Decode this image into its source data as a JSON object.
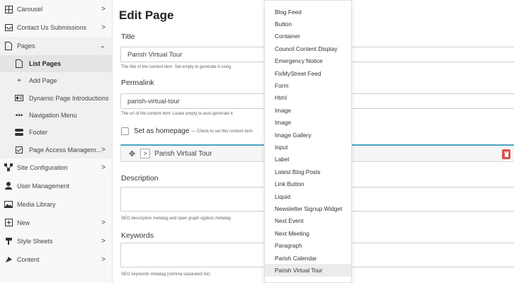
{
  "sidebar": {
    "items": [
      {
        "label": "Carousel",
        "icon": "carousel-icon",
        "chevron": ">"
      },
      {
        "label": "Contact Us Submissions",
        "icon": "inbox-icon",
        "chevron": ">"
      },
      {
        "label": "Pages",
        "icon": "page-icon",
        "chevron": "⌄"
      },
      {
        "label": "List Pages",
        "icon": "page-icon"
      },
      {
        "label": "Add Page",
        "icon": "plus-icon"
      },
      {
        "label": "Dynamic Page Introductions",
        "icon": "id-card-icon"
      },
      {
        "label": "Navigation Menu",
        "icon": "ellipsis-icon"
      },
      {
        "label": "Footer",
        "icon": "footer-icon"
      },
      {
        "label": "Page Access Managem...",
        "icon": "checkbox-icon",
        "chevron": ">"
      },
      {
        "label": "Site Configuration",
        "icon": "sitemap-icon",
        "chevron": ">"
      },
      {
        "label": "User Management",
        "icon": "user-icon"
      },
      {
        "label": "Media Library",
        "icon": "image-icon"
      },
      {
        "label": "New",
        "icon": "plus-square-icon",
        "chevron": ">"
      },
      {
        "label": "Style Sheets",
        "icon": "paint-icon",
        "chevron": ">"
      },
      {
        "label": "Content",
        "icon": "content-icon",
        "chevron": ">"
      }
    ]
  },
  "main": {
    "title": "Edit Page",
    "title_field": {
      "label": "Title",
      "value": "Parish Virtual Tour",
      "help": "The title of the content item. Set empty to generate it using"
    },
    "permalink_field": {
      "label": "Permalink",
      "value": "parish-virtual-tour",
      "help": "The url of the content item. Leave empty to auto-generate it"
    },
    "homepage": {
      "label": "Set as homepage",
      "help": "— Check to set this content item"
    },
    "block": {
      "label": "Parish Virtual Tour",
      "expand": ">"
    },
    "description_field": {
      "label": "Description",
      "value": "",
      "help": "SEO description metatag and open graph ogdesc metatag"
    },
    "keywords_field": {
      "label": "Keywords",
      "value": "",
      "help": "SEO keywords metatag (comma separated list)"
    }
  },
  "dropdown": {
    "items": [
      "Blog Feed",
      "Button",
      "Container",
      "Council Content Display",
      "Emergency Notice",
      "FixMyStreet Feed",
      "Form",
      "Html",
      "Image",
      "Image",
      "Image Gallery",
      "Input",
      "Label",
      "Latest Blog Posts",
      "Link Button",
      "Liquid",
      "Newsletter Signup Widget",
      "Next Event",
      "Next Meeting",
      "Paragraph",
      "Parish Calendar",
      "Parish Virtual Tour"
    ],
    "highlighted": "Parish Virtual Tour"
  },
  "colors": {
    "accent_line": "#4aa3c8",
    "danger": "#d9534f",
    "sidebar_bg": "#f8f8f8",
    "active_bg": "#e4e4e4"
  }
}
